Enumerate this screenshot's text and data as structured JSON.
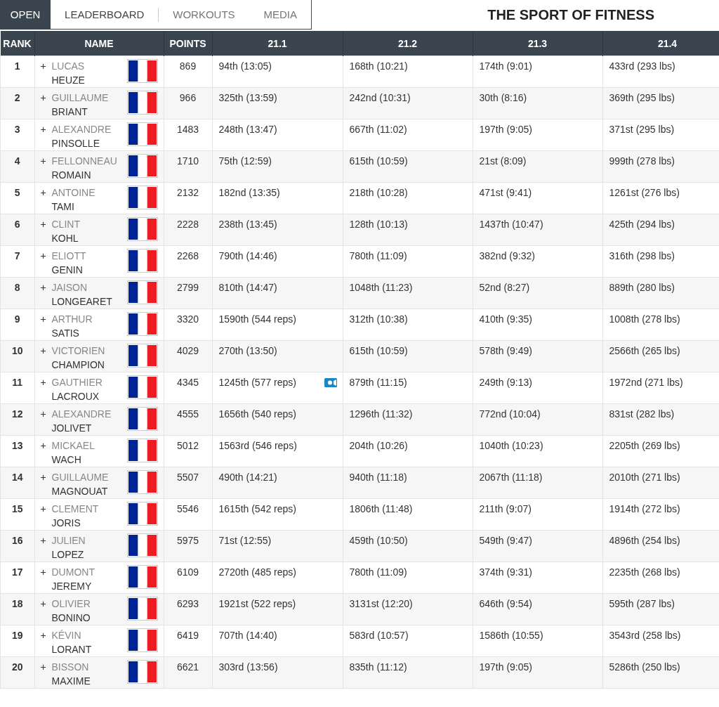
{
  "tabs": [
    {
      "label": "OPEN",
      "selected": true
    },
    {
      "label": "LEADERBOARD",
      "selected": false
    },
    {
      "label": "WORKOUTS",
      "selected": false
    },
    {
      "label": "MEDIA",
      "selected": false
    }
  ],
  "title": "THE SPORT OF FITNESS",
  "table": {
    "columns": [
      "RANK",
      "NAME",
      "POINTS",
      "21.1",
      "21.2",
      "21.3",
      "21.4"
    ],
    "expand_symbol": "+",
    "rows": [
      {
        "rank": "1",
        "first": "LUCAS",
        "last": "HEUZE",
        "points": "869",
        "scores": [
          "94th (13:05)",
          "168th (10:21)",
          "174th (9:01)",
          "433rd (293 lbs)"
        ],
        "video": false
      },
      {
        "rank": "2",
        "first": "GUILLAUME",
        "last": "BRIANT",
        "points": "966",
        "scores": [
          "325th (13:59)",
          "242nd (10:31)",
          "30th (8:16)",
          "369th (295 lbs)"
        ],
        "video": false
      },
      {
        "rank": "3",
        "first": "ALEXANDRE",
        "last": "PINSOLLE",
        "points": "1483",
        "scores": [
          "248th (13:47)",
          "667th (11:02)",
          "197th (9:05)",
          "371st (295 lbs)"
        ],
        "video": false
      },
      {
        "rank": "4",
        "first": "FELLONNEAU",
        "last": "ROMAIN",
        "points": "1710",
        "scores": [
          "75th (12:59)",
          "615th (10:59)",
          "21st (8:09)",
          "999th (278 lbs)"
        ],
        "video": false
      },
      {
        "rank": "5",
        "first": "ANTOINE",
        "last": "TAMI",
        "points": "2132",
        "scores": [
          "182nd (13:35)",
          "218th (10:28)",
          "471st (9:41)",
          "1261st (276 lbs)"
        ],
        "video": false
      },
      {
        "rank": "6",
        "first": "CLINT",
        "last": "KOHL",
        "points": "2228",
        "scores": [
          "238th (13:45)",
          "128th (10:13)",
          "1437th (10:47)",
          "425th (294 lbs)"
        ],
        "video": false
      },
      {
        "rank": "7",
        "first": "ELIOTT",
        "last": "GENIN",
        "points": "2268",
        "scores": [
          "790th (14:46)",
          "780th (11:09)",
          "382nd (9:32)",
          "316th (298 lbs)"
        ],
        "video": false
      },
      {
        "rank": "8",
        "first": "JAISON",
        "last": "LONGEARET",
        "points": "2799",
        "scores": [
          "810th (14:47)",
          "1048th (11:23)",
          "52nd (8:27)",
          "889th (280 lbs)"
        ],
        "video": false
      },
      {
        "rank": "9",
        "first": "ARTHUR",
        "last": "SATIS",
        "points": "3320",
        "scores": [
          "1590th (544 reps)",
          "312th (10:38)",
          "410th (9:35)",
          "1008th (278 lbs)"
        ],
        "video": false
      },
      {
        "rank": "10",
        "first": "VICTORIEN",
        "last": "CHAMPION",
        "points": "4029",
        "scores": [
          "270th (13:50)",
          "615th (10:59)",
          "578th (9:49)",
          "2566th (265 lbs)"
        ],
        "video": false
      },
      {
        "rank": "11",
        "first": "GAUTHIER",
        "last": "LACROUX",
        "points": "4345",
        "scores": [
          "1245th (577 reps)",
          "879th (11:15)",
          "249th (9:13)",
          "1972nd (271 lbs)"
        ],
        "video": true
      },
      {
        "rank": "12",
        "first": "ALEXANDRE",
        "last": "JOLIVET",
        "points": "4555",
        "scores": [
          "1656th (540 reps)",
          "1296th (11:32)",
          "772nd (10:04)",
          "831st (282 lbs)"
        ],
        "video": false
      },
      {
        "rank": "13",
        "first": "MICKAEL",
        "last": "WACH",
        "points": "5012",
        "scores": [
          "1563rd (546 reps)",
          "204th (10:26)",
          "1040th (10:23)",
          "2205th (269 lbs)"
        ],
        "video": false
      },
      {
        "rank": "14",
        "first": "GUILLAUME",
        "last": "MAGNOUAT",
        "points": "5507",
        "scores": [
          "490th (14:21)",
          "940th (11:18)",
          "2067th (11:18)",
          "2010th (271 lbs)"
        ],
        "video": false
      },
      {
        "rank": "15",
        "first": "CLEMENT",
        "last": "JORIS",
        "points": "5546",
        "scores": [
          "1615th (542 reps)",
          "1806th (11:48)",
          "211th (9:07)",
          "1914th (272 lbs)"
        ],
        "video": false
      },
      {
        "rank": "16",
        "first": "JULIEN",
        "last": "LOPEZ",
        "points": "5975",
        "scores": [
          "71st (12:55)",
          "459th (10:50)",
          "549th (9:47)",
          "4896th (254 lbs)"
        ],
        "video": false
      },
      {
        "rank": "17",
        "first": "DUMONT",
        "last": "JEREMY",
        "points": "6109",
        "scores": [
          "2720th (485 reps)",
          "780th (11:09)",
          "374th (9:31)",
          "2235th (268 lbs)"
        ],
        "video": false
      },
      {
        "rank": "18",
        "first": "OLIVIER",
        "last": "BONINO",
        "points": "6293",
        "scores": [
          "1921st (522 reps)",
          "3131st (12:20)",
          "646th (9:54)",
          "595th (287 lbs)"
        ],
        "video": false
      },
      {
        "rank": "19",
        "first": "KÉVIN",
        "last": "LORANT",
        "points": "6419",
        "scores": [
          "707th (14:40)",
          "583rd (10:57)",
          "1586th (10:55)",
          "3543rd (258 lbs)"
        ],
        "video": false
      },
      {
        "rank": "20",
        "first": "BISSON",
        "last": "MAXIME",
        "points": "6621",
        "scores": [
          "303rd (13:56)",
          "835th (11:12)",
          "197th (9:05)",
          "5286th (250 lbs)"
        ],
        "video": false
      }
    ]
  }
}
